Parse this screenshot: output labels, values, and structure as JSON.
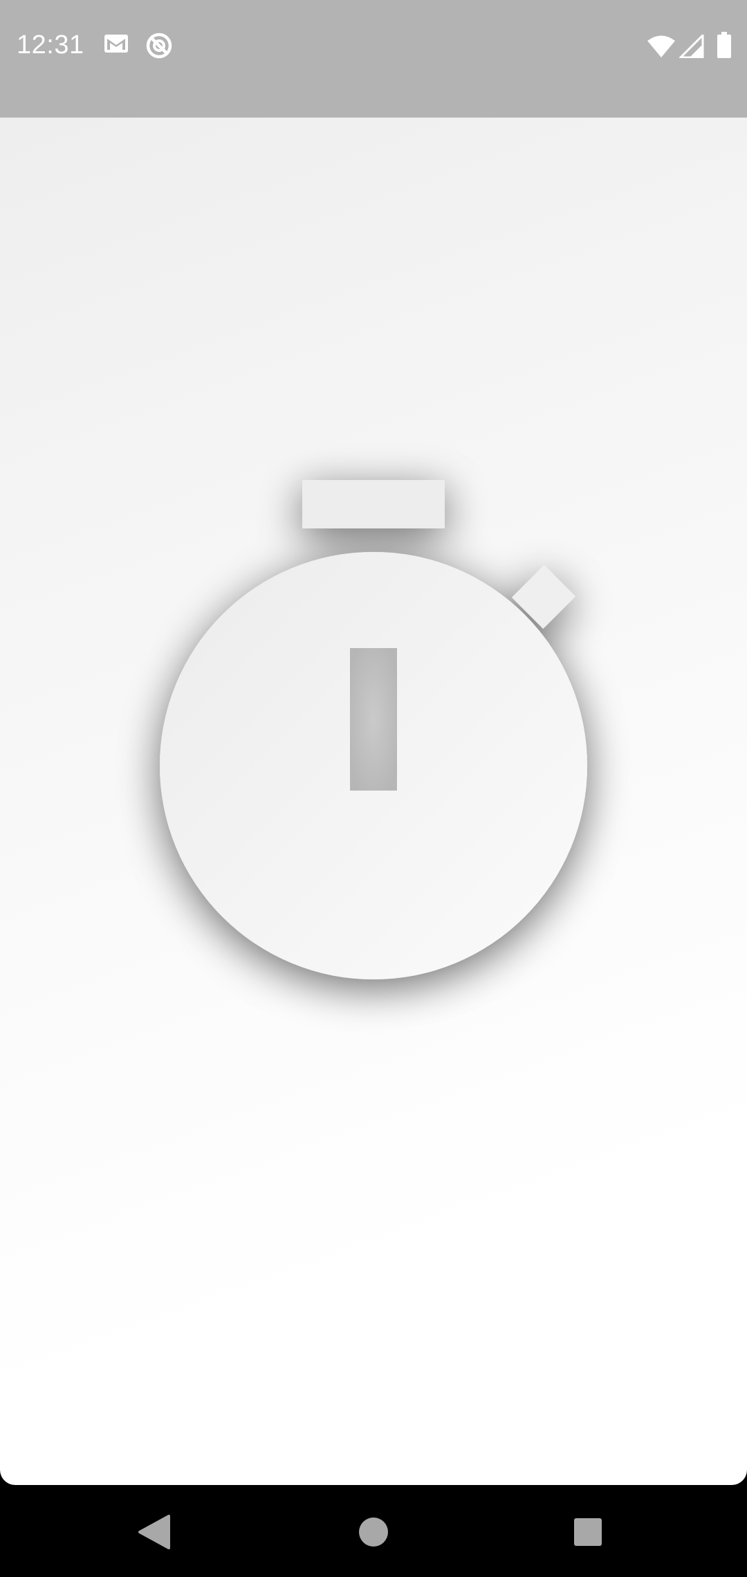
{
  "status_bar": {
    "time": "12:31",
    "notification_icons": [
      "gmail-icon",
      "do-not-disturb-icon"
    ],
    "system_icons": [
      "wifi-icon",
      "cellular-signal-icon",
      "battery-icon"
    ]
  },
  "splash": {
    "icon": "stopwatch-icon"
  },
  "navigation_bar": {
    "buttons": [
      "back",
      "home",
      "recents"
    ]
  },
  "colors": {
    "status_bar": "#b3b3b3",
    "icon_fill": "#efefef",
    "icon_slot": "#c6c6c6",
    "nav_bar": "#000000",
    "nav_buttons": "#a8a8a8"
  }
}
